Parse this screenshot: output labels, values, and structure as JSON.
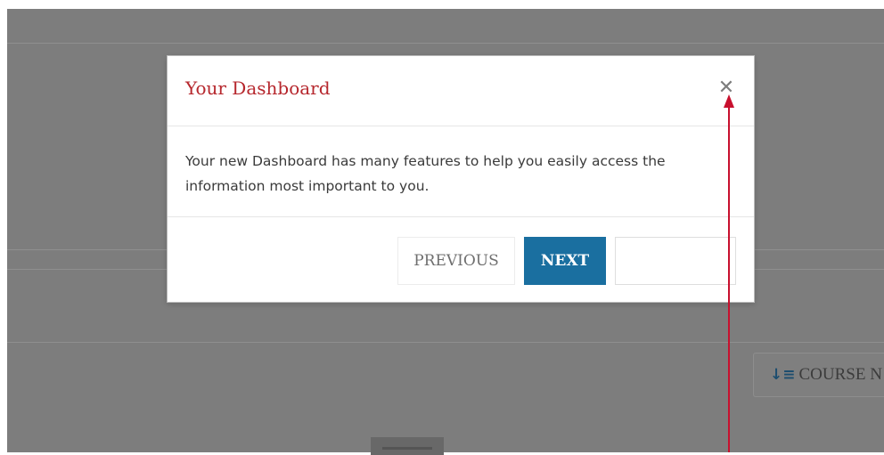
{
  "background": {
    "sort_button": {
      "icon": "sort-descending-icon",
      "icon_glyph": "↓≡",
      "label": "COURSE N"
    }
  },
  "modal": {
    "title": "Your Dashboard",
    "close_icon": "close-icon",
    "close_glyph": "✕",
    "body_text": "Your new Dashboard has many features to help you easily access the information most important to you.",
    "buttons": {
      "previous_label": "PREVIOUS",
      "next_label": "NEXT",
      "extra_label": ""
    }
  },
  "annotation": {
    "arrow_color": "#c8102e",
    "type": "arrow-pointing-to-close"
  },
  "colors": {
    "title": "#b6272d",
    "next_button": "#1a6fa0",
    "overlay": "#7d7d7d"
  }
}
